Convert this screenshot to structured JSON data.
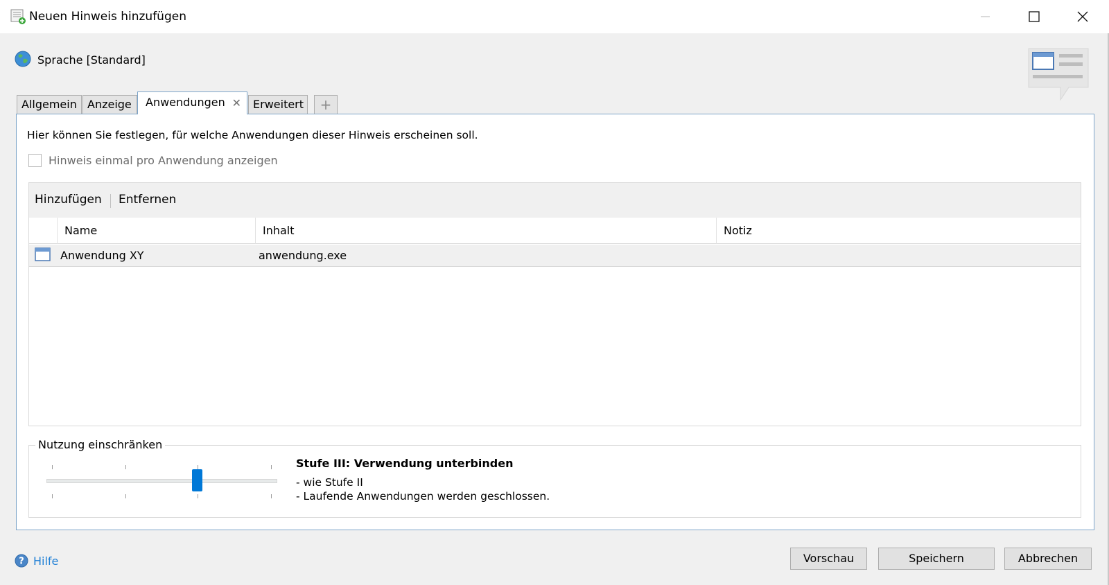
{
  "window": {
    "title": "Neuen Hinweis hinzufügen"
  },
  "language": {
    "label": "Sprache [Standard]"
  },
  "tabs": [
    {
      "label": "Allgemein"
    },
    {
      "label": "Anzeige"
    },
    {
      "label": "Anwendungen",
      "active": true
    },
    {
      "label": "Erweitert"
    },
    {
      "label": "+"
    }
  ],
  "panel": {
    "description": "Hier können Sie festlegen, für welche Anwendungen dieser Hinweis erscheinen soll.",
    "once_checkbox_label": "Hinweis einmal pro Anwendung anzeigen",
    "once_checked": false
  },
  "list": {
    "add_label": "Hinzufügen",
    "remove_label": "Entfernen",
    "columns": [
      "Name",
      "Inhalt",
      "Notiz"
    ],
    "rows": [
      {
        "name": "Anwendung XY",
        "inhalt": "anwendung.exe",
        "notiz": ""
      }
    ]
  },
  "restriction": {
    "legend": "Nutzung einschränken",
    "slider_level": 3,
    "slider_max": 4,
    "level_title": "Stufe III: Verwendung unterbinden",
    "level_lines": [
      "- wie Stufe II",
      "- Laufende Anwendungen werden geschlossen."
    ]
  },
  "footer": {
    "help_label": "Hilfe",
    "preview_label": "Vorschau",
    "save_label": "Speichern",
    "cancel_label": "Abbrechen"
  },
  "colors": {
    "accent": "#0078d7",
    "tab_border": "#7ca4c9",
    "link": "#1e7fd6"
  },
  "icons": {
    "title": "note-add-icon",
    "language": "globe-icon",
    "decoration": "speech-bubble-window-icon",
    "row": "window-app-icon",
    "help": "help-icon"
  }
}
